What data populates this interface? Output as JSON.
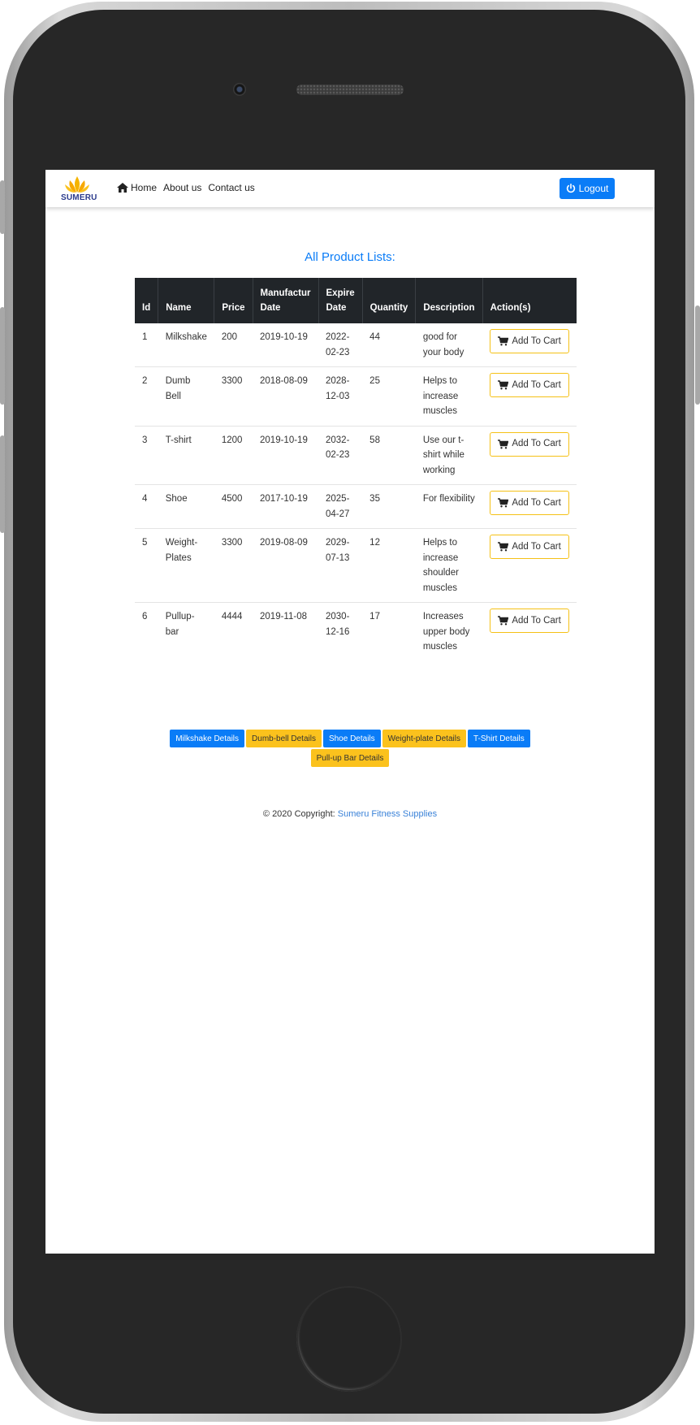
{
  "brand": {
    "logo_text": "SUMERU"
  },
  "nav": {
    "home": "Home",
    "about": "About us",
    "contact": "Contact us",
    "logout": "Logout"
  },
  "page": {
    "title": "All Product Lists:"
  },
  "table": {
    "headers": [
      "Id",
      "Name",
      "Price",
      "Manufactur Date",
      "Expire Date",
      "Quantity",
      "Description",
      "Action(s)"
    ],
    "rows": [
      {
        "id": "1",
        "name": "Milkshake",
        "price": "200",
        "mfg": "2019-10-19",
        "exp": "2022-02-23",
        "qty": "44",
        "desc": "good for your body",
        "action": "Add To Cart"
      },
      {
        "id": "2",
        "name": "Dumb Bell",
        "price": "3300",
        "mfg": "2018-08-09",
        "exp": "2028-12-03",
        "qty": "25",
        "desc": "Helps to increase muscles",
        "action": "Add To Cart"
      },
      {
        "id": "3",
        "name": "T-shirt",
        "price": "1200",
        "mfg": "2019-10-19",
        "exp": "2032-02-23",
        "qty": "58",
        "desc": "Use our t-shirt while working",
        "action": "Add To Cart"
      },
      {
        "id": "4",
        "name": "Shoe",
        "price": "4500",
        "mfg": "2017-10-19",
        "exp": "2025-04-27",
        "qty": "35",
        "desc": "For flexibility",
        "action": "Add To Cart"
      },
      {
        "id": "5",
        "name": "Weight-Plates",
        "price": "3300",
        "mfg": "2019-08-09",
        "exp": "2029-07-13",
        "qty": "12",
        "desc": "Helps to increase shoulder muscles",
        "action": "Add To Cart"
      },
      {
        "id": "6",
        "name": "Pullup-bar",
        "price": "4444",
        "mfg": "2019-11-08",
        "exp": "2030-12-16",
        "qty": "17",
        "desc": "Increases upper body muscles",
        "action": "Add To Cart"
      }
    ]
  },
  "details_buttons": [
    {
      "label": "Milkshake Details",
      "color": "#0a7cf7"
    },
    {
      "label": "Dumb-bell Details",
      "color": "#fbc21d"
    },
    {
      "label": "Shoe Details",
      "color": "#0a7cf7"
    },
    {
      "label": "Weight-plate Details",
      "color": "#fbc21d"
    },
    {
      "label": "T-Shirt Details",
      "color": "#0a7cf7"
    },
    {
      "label": "Pull-up Bar Details",
      "color": "#fbc21d"
    }
  ],
  "footer": {
    "copyright": "© 2020 Copyright:",
    "brand": "Sumeru Fitness Supplies"
  },
  "colors": {
    "primary": "#0a7cf7",
    "warning": "#fbc21d",
    "table_header": "#212529"
  },
  "icons": {
    "home": "home-icon",
    "logout": "power-icon",
    "cart": "cart-icon"
  }
}
